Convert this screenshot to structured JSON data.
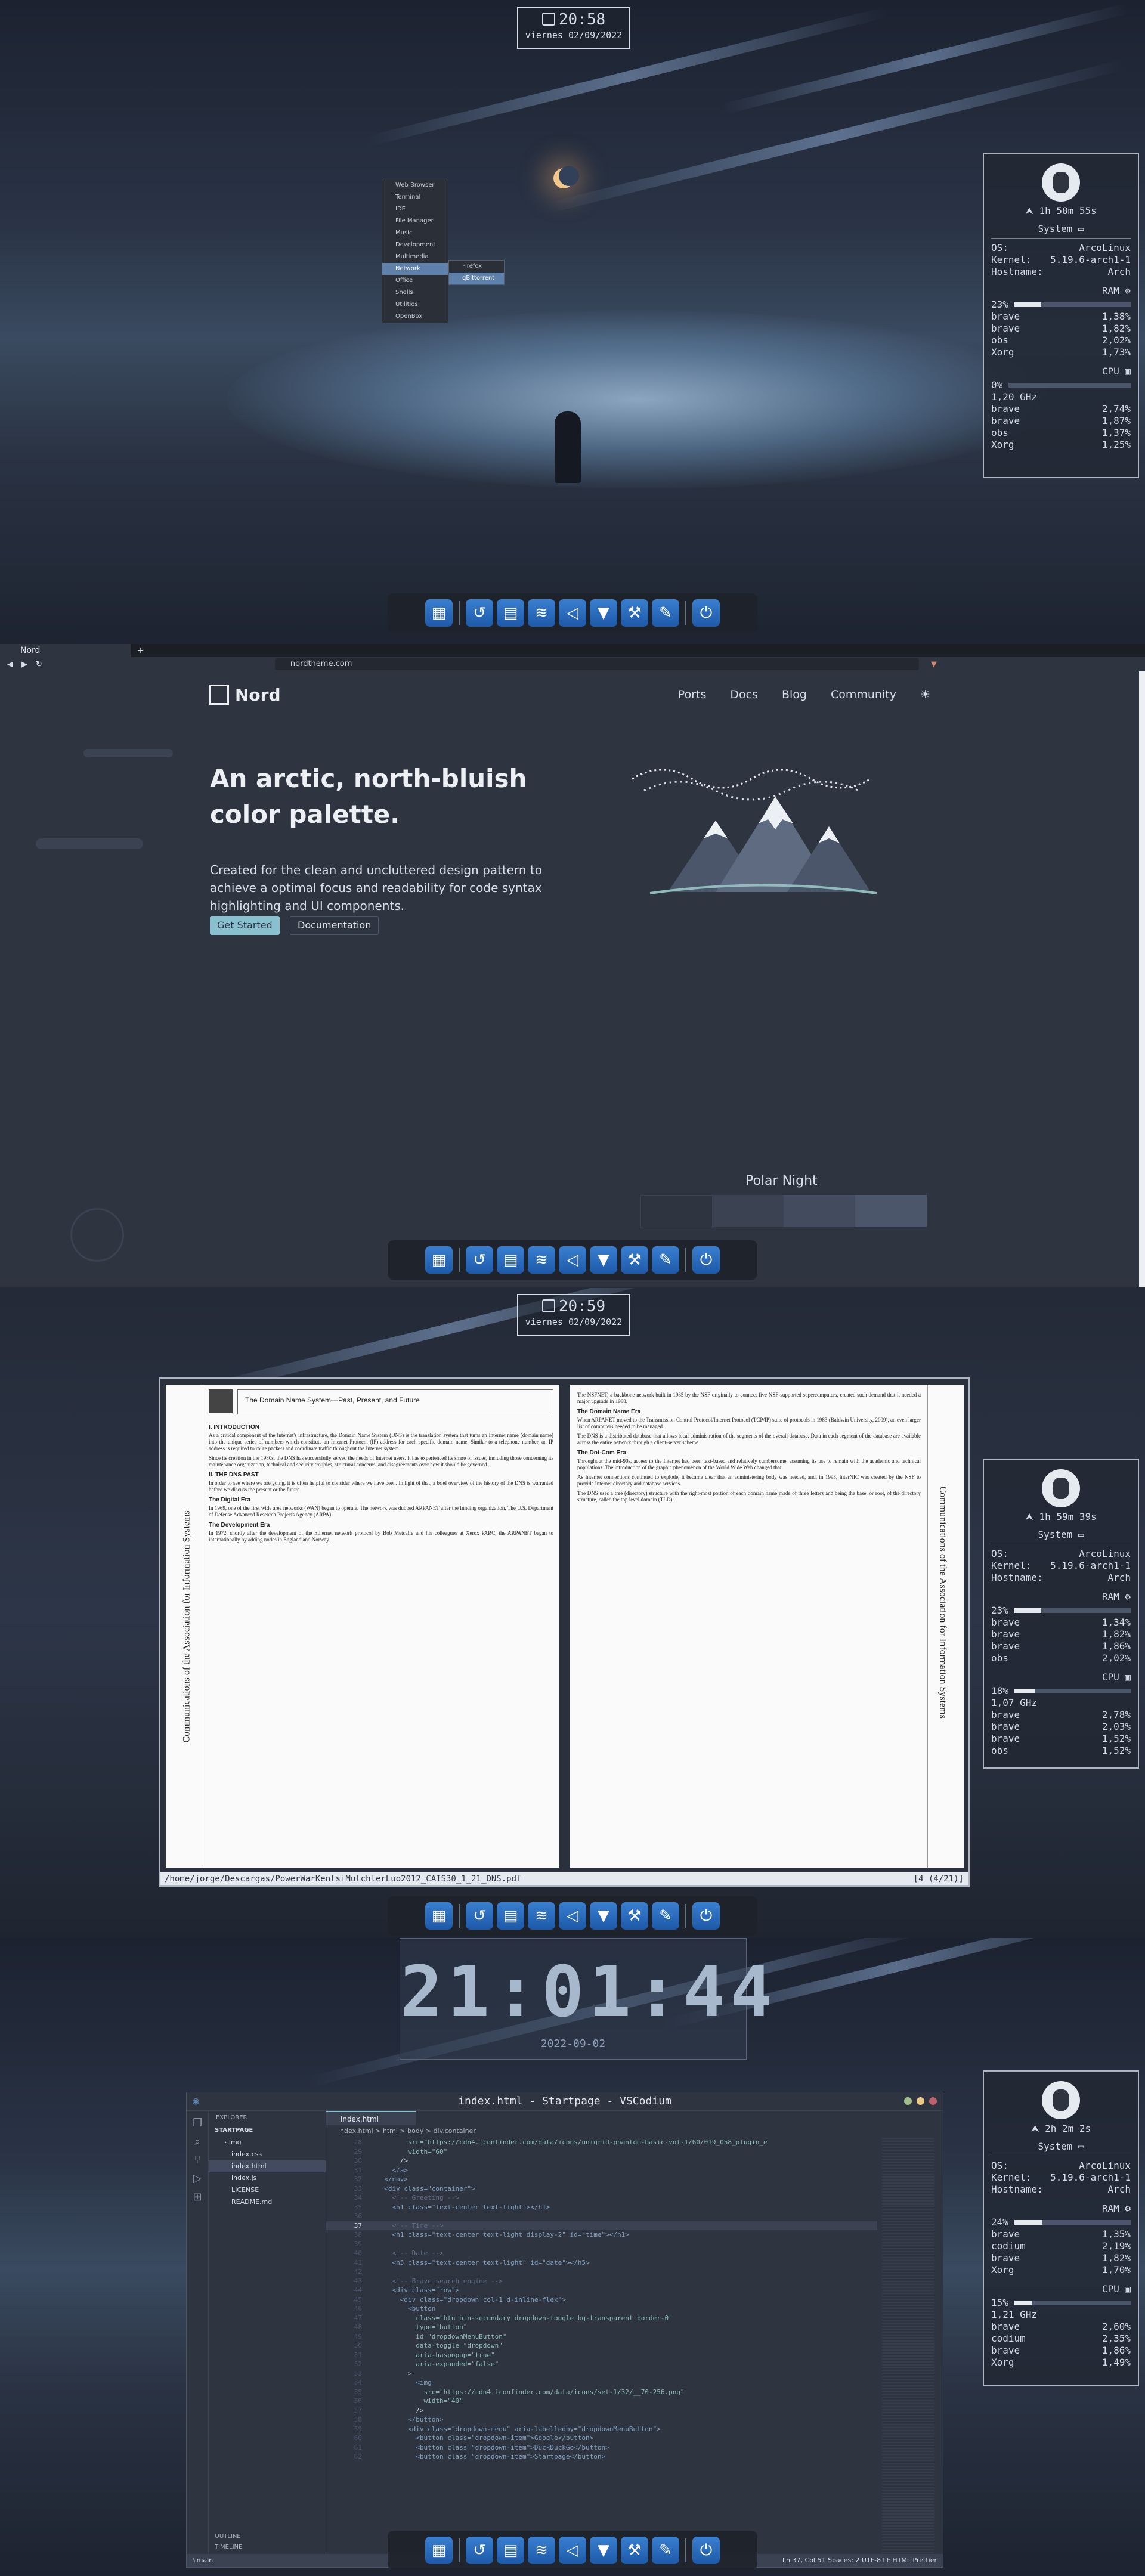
{
  "colors": {
    "nord0": "#2e3440",
    "nord8": "#88c0d0",
    "frost": "#5e81ac",
    "snow": "#eceff4"
  },
  "clock1": {
    "time": "20:58",
    "date": "viernes 02/09/2022"
  },
  "clock2": {
    "time": "20:59",
    "date": "viernes 02/09/2022"
  },
  "bigclock": {
    "time": "21:01:44",
    "date": "2022-09-02"
  },
  "conky1": {
    "uptime": "1h 58m 55s",
    "system": "System",
    "os_k": "OS:",
    "os_v": "ArcoLinux",
    "kernel_k": "Kernel:",
    "kernel_v": "5.19.6-arch1-1",
    "host_k": "Hostname:",
    "host_v": "Arch",
    "ram": "RAM",
    "ram_pct": "23%",
    "ram_fill": 0.23,
    "ram_procs": [
      {
        "n": "brave",
        "v": "1,38%"
      },
      {
        "n": "brave",
        "v": "1,82%"
      },
      {
        "n": "obs",
        "v": "2,02%"
      },
      {
        "n": "Xorg",
        "v": "1,73%"
      }
    ],
    "cpu": "CPU",
    "cpu_pct": "0%",
    "cpu_fill": 0.0,
    "freq": "1,20 GHz",
    "cpu_procs": [
      {
        "n": "brave",
        "v": "2,74%"
      },
      {
        "n": "brave",
        "v": "1,87%"
      },
      {
        "n": "obs",
        "v": "1,37%"
      },
      {
        "n": "Xorg",
        "v": "1,25%"
      }
    ]
  },
  "conky2": {
    "uptime": "1h 59m 39s",
    "system": "System",
    "os_k": "OS:",
    "os_v": "ArcoLinux",
    "kernel_k": "Kernel:",
    "kernel_v": "5.19.6-arch1-1",
    "host_k": "Hostname:",
    "host_v": "Arch",
    "ram": "RAM",
    "ram_pct": "23%",
    "ram_fill": 0.23,
    "ram_procs": [
      {
        "n": "brave",
        "v": "1,34%"
      },
      {
        "n": "brave",
        "v": "1,82%"
      },
      {
        "n": "brave",
        "v": "1,86%"
      },
      {
        "n": "obs",
        "v": "2,02%"
      }
    ],
    "cpu": "CPU",
    "cpu_pct": "18%",
    "cpu_fill": 0.18,
    "freq": "1,07 GHz",
    "cpu_procs": [
      {
        "n": "brave",
        "v": "2,78%"
      },
      {
        "n": "brave",
        "v": "2,03%"
      },
      {
        "n": "brave",
        "v": "1,52%"
      },
      {
        "n": "obs",
        "v": "1,52%"
      }
    ]
  },
  "conky3": {
    "uptime": "2h 2m 2s",
    "system": "System",
    "os_k": "OS:",
    "os_v": "ArcoLinux",
    "kernel_k": "Kernel:",
    "kernel_v": "5.19.6-arch1-1",
    "host_k": "Hostname:",
    "host_v": "Arch",
    "ram": "RAM",
    "ram_pct": "24%",
    "ram_fill": 0.24,
    "ram_procs": [
      {
        "n": "brave",
        "v": "1,35%"
      },
      {
        "n": "codium",
        "v": "2,19%"
      },
      {
        "n": "brave",
        "v": "1,82%"
      },
      {
        "n": "Xorg",
        "v": "1,70%"
      }
    ],
    "cpu": "CPU",
    "cpu_pct": "15%",
    "cpu_fill": 0.15,
    "freq": "1,21 GHz",
    "cpu_procs": [
      {
        "n": "brave",
        "v": "2,60%"
      },
      {
        "n": "codium",
        "v": "2,35%"
      },
      {
        "n": "brave",
        "v": "1,86%"
      },
      {
        "n": "Xorg",
        "v": "1,49%"
      }
    ]
  },
  "dock_icons": [
    "apps-grid-icon",
    "arcolinux-icon",
    "file-manager-icon",
    "media-icon",
    "vscodium-icon",
    "brave-icon",
    "hammer-icon",
    "notes-icon",
    "power-icon"
  ],
  "context_menu": {
    "items": [
      "Web Browser",
      "Terminal",
      "IDE",
      "File Manager",
      "Music",
      "Development",
      "Multimedia",
      "Network",
      "Office",
      "Shells",
      "Utilities",
      "OpenBox"
    ],
    "submenu": [
      "Firefox",
      "qBittorrent"
    ]
  },
  "browser": {
    "tab": "Nord",
    "url": "nordtheme.com",
    "brand": "Nord",
    "nav": [
      "Ports",
      "Docs",
      "Blog",
      "Community"
    ],
    "hero_title": "An arctic, north-bluish color palette.",
    "hero_text": "Created for the clean and uncluttered design pattern to achieve a optimal focus and readability for code syntax highlighting and UI components.",
    "btn_start": "Get Started",
    "btn_docs": "Documentation",
    "section": "Polar Night",
    "swatches": [
      "#2e3440",
      "#3b4252",
      "#434c5e",
      "#4c566a"
    ]
  },
  "pdf": {
    "vertical_title": "Communications of the Association for Information Systems",
    "title": "The Domain Name System—Past, Present, and Future",
    "h_intro": "I. INTRODUCTION",
    "p_intro": "As a critical component of the Internet's infrastructure, the Domain Name System (DNS) is the translation system that turns an Internet name (domain name) into the unique series of numbers which constitute an Internet Protocol (IP) address for each specific domain name. Similar to a telephone number, an IP address is required to route packets and coordinate traffic throughout the Internet system.",
    "p_intro2": "Since its creation in the 1980s, the DNS has successfully served the needs of Internet users. It has experienced its share of issues, including those concerning its maintenance organization, technical and security troubles, structural concerns, and disagreements over how it should be governed.",
    "h_past": "II. THE DNS PAST",
    "p_past": "In order to see where we are going, it is often helpful to consider where we have been. In light of that, a brief overview of the history of the DNS is warranted before we discuss the present or the future.",
    "h_digital": "The Digital Era",
    "p_digital": "In 1969, one of the first wide area networks (WAN) began to operate. The network was dubbed ARPANET after the funding organization, The U.S. Department of Defense Advanced Research Projects Agency (ARPA).",
    "h_dev": "The Development Era",
    "p_dev": "In 1972, shortly after the development of the Ethernet network protocol by Bob Metcalfe and his colleagues at Xerox PARC, the ARPANET began to internationally by adding nodes in England and Norway.",
    "p_right1": "The NSFNET, a backbone network built in 1985 by the NSF originally to connect five NSF-supported supercomputers, created such demand that it needed a major upgrade in 1988.",
    "h_domain": "The Domain Name Era",
    "p_domain": "When ARPANET moved to the Transmission Control Protocol/Internet Protocol (TCP/IP) suite of protocols in 1983 (Baldwin University, 2009), an even larger list of computers needed to be managed.",
    "p_domain2": "The DNS is a distributed database that allows local administration of the segments of the overall database. Data in each segment of the database are available across the entire network through a client-server scheme.",
    "h_dotcom": "The Dot-Com Era",
    "p_dotcom": "Throughout the mid-90s, access to the Internet had been text-based and relatively cumbersome, assuming its use to remain with the academic and technical populations. The introduction of the graphic phenomenon of the World Wide Web changed that.",
    "p_dotcom2": "As Internet connections continued to explode, it became clear that an administering body was needed, and, in 1993, InterNIC was created by the NSF to provide Internet directory and database services.",
    "p_dotcom3": "The DNS uses a tree (directory) structure with the right-most portion of each domain name made of three letters and being the base, or root, of the directory structure, called the top level domain (TLD).",
    "path": "/home/jorge/Descargas/PowerWarKentsiMutchlerLuo2012_CAIS30_1_21_DNS.pdf",
    "pagecount": "[4 (4/21)]"
  },
  "vscode": {
    "title": "index.html - Startpage - VSCodium",
    "explorer": "EXPLORER",
    "root": "STARTPAGE",
    "files": [
      "img",
      "index.css",
      "index.html",
      "index.js",
      "LICENSE",
      "README.md"
    ],
    "outline": "OUTLINE",
    "timeline": "TIMELINE",
    "tab": "index.html",
    "crumb": "index.html > html > body > div.container",
    "lines": [
      {
        "n": "28",
        "h": "        src=\"https://cdn4.iconfinder.com/data/icons/unigrid-phantom-basic-vol-1/60/019_058_plugin_e"
      },
      {
        "n": "29",
        "h": "        width=\"60\""
      },
      {
        "n": "30",
        "h": "      />"
      },
      {
        "n": "31",
        "h": "    </a>"
      },
      {
        "n": "32",
        "h": "  </nav>"
      },
      {
        "n": "33",
        "h": "  <div class=\"container\">"
      },
      {
        "n": "34",
        "h": "    <!-- Greeting -->"
      },
      {
        "n": "35",
        "h": "    <h1 class=\"text-center text-light\"></h1>"
      },
      {
        "n": "36",
        "h": ""
      },
      {
        "n": "37",
        "h": "    <!-- Time -->"
      },
      {
        "n": "38",
        "h": "    <h1 class=\"text-center text-light display-2\" id=\"time\"></h1>"
      },
      {
        "n": "39",
        "h": ""
      },
      {
        "n": "40",
        "h": "    <!-- Date -->"
      },
      {
        "n": "41",
        "h": "    <h5 class=\"text-center text-light\" id=\"date\"></h5>"
      },
      {
        "n": "42",
        "h": ""
      },
      {
        "n": "43",
        "h": "    <!-- Brave search engine -->"
      },
      {
        "n": "44",
        "h": "    <div class=\"row\">"
      },
      {
        "n": "45",
        "h": "      <div class=\"dropdown col-1 d-inline-flex\">"
      },
      {
        "n": "46",
        "h": "        <button"
      },
      {
        "n": "47",
        "h": "          class=\"btn btn-secondary dropdown-toggle bg-transparent border-0\""
      },
      {
        "n": "48",
        "h": "          type=\"button\""
      },
      {
        "n": "49",
        "h": "          id=\"dropdownMenuButton\""
      },
      {
        "n": "50",
        "h": "          data-toggle=\"dropdown\""
      },
      {
        "n": "51",
        "h": "          aria-haspopup=\"true\""
      },
      {
        "n": "52",
        "h": "          aria-expanded=\"false\""
      },
      {
        "n": "53",
        "h": "        >"
      },
      {
        "n": "54",
        "h": "          <img"
      },
      {
        "n": "55",
        "h": "            src=\"https://cdn4.iconfinder.com/data/icons/set-1/32/__70-256.png\""
      },
      {
        "n": "56",
        "h": "            width=\"40\""
      },
      {
        "n": "57",
        "h": "          />"
      },
      {
        "n": "58",
        "h": "        </button>"
      },
      {
        "n": "59",
        "h": "        <div class=\"dropdown-menu\" aria-labelledby=\"dropdownMenuButton\">"
      },
      {
        "n": "60",
        "h": "          <button class=\"dropdown-item\">Google</button>"
      },
      {
        "n": "61",
        "h": "          <button class=\"dropdown-item\">DuckDuckGo</button>"
      },
      {
        "n": "62",
        "h": "          <button class=\"dropdown-item\">Startpage</button>"
      }
    ],
    "status_left": "main",
    "status_right": "Ln 37, Col 51   Spaces: 2   UTF-8   LF   HTML   Prettier"
  }
}
